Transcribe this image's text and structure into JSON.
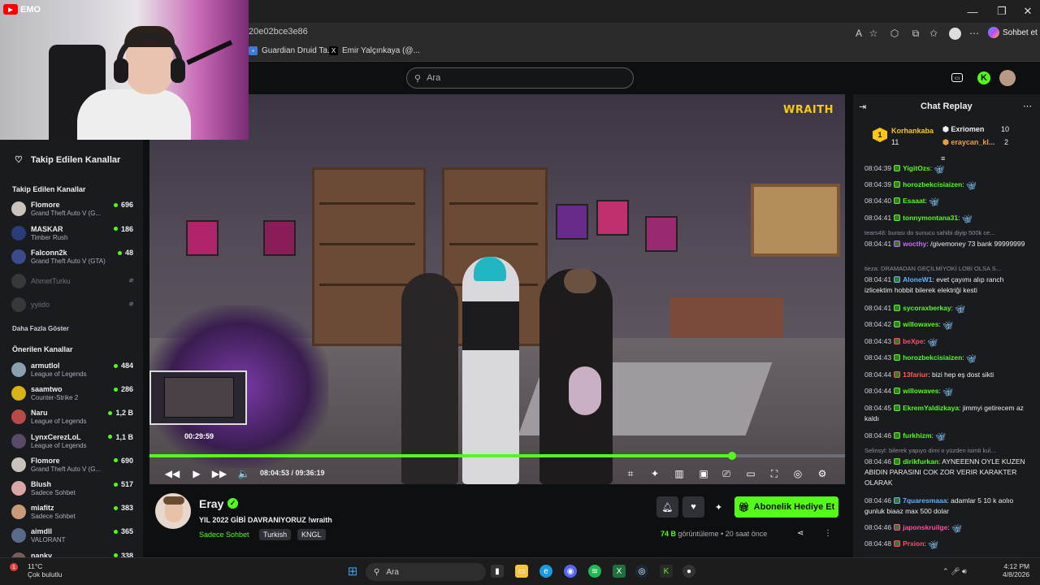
{
  "browser": {
    "url_fragment": "20e02bce3e86",
    "bookmarks": [
      {
        "label": "Guardian Druid Ta..."
      },
      {
        "label": "Emir Yalçınkaya (@..."
      }
    ],
    "copilot_label": "Sohbet et"
  },
  "overlay": {
    "youtube_badge": "EMO"
  },
  "header": {
    "search_placeholder": "Ara"
  },
  "sidebar": {
    "title": "Takip Edilen Kanallar",
    "followed_heading": "Takip Edilen Kanallar",
    "followed": [
      {
        "name": "Flomore",
        "game": "Grand Theft Auto V (G...",
        "viewers": "696",
        "color": "#c9c2bd"
      },
      {
        "name": "MASKAR",
        "game": "Timber Rush",
        "viewers": "186",
        "color": "#2b3c7a"
      },
      {
        "name": "Falconn2k",
        "game": "Grand Theft Auto V (GTA)",
        "viewers": "48",
        "color": "#3a4a8a"
      },
      {
        "name": "AhmetTurku",
        "game": "",
        "viewers": "",
        "color": "#555"
      },
      {
        "name": "yyiido",
        "game": "",
        "viewers": "",
        "color": "#555"
      }
    ],
    "show_more": "Daha Fazla Göster",
    "recommended_heading": "Önerilen Kanallar",
    "recommended": [
      {
        "name": "armutlol",
        "game": "League of Legends",
        "viewers": "484",
        "color": "#8a9fb0"
      },
      {
        "name": "saamtwo",
        "game": "Counter-Strike 2",
        "viewers": "286",
        "color": "#d9b215"
      },
      {
        "name": "Naru",
        "game": "League of Legends",
        "viewers": "1,2 B",
        "color": "#b84a4a"
      },
      {
        "name": "LynxCerezLoL",
        "game": "League of Legends",
        "viewers": "1,1 B",
        "color": "#5a4a6a"
      },
      {
        "name": "Flomore",
        "game": "Grand Theft Auto V (G...",
        "viewers": "690",
        "color": "#c9c2bd"
      },
      {
        "name": "Blush",
        "game": "Sadece Sohbet",
        "viewers": "517",
        "color": "#d9a5a5"
      },
      {
        "name": "miafitz",
        "game": "Sadece Sohbet",
        "viewers": "383",
        "color": "#c99a7a"
      },
      {
        "name": "aimdll",
        "game": "VALORANT",
        "viewers": "365",
        "color": "#5a6a8a"
      },
      {
        "name": "nanky",
        "game": "",
        "viewers": "338",
        "color": "#7a5a5a"
      }
    ]
  },
  "video": {
    "watermark": "WRAITH",
    "hover_time": "00:29:59",
    "progress_fraction": 0.838,
    "current_time": "08:04:53",
    "duration": "09:36:19",
    "time_display": "08:04:53 / 09:36:19"
  },
  "stream": {
    "streamer": "Eray",
    "title": "YIL 2022 GİBİ DAVRANIYORUZ  !wraith",
    "category": "Sadece Sohbet",
    "tags": [
      "Turkish",
      "KNGL"
    ],
    "gift_button": "Abonelik Hediye Et",
    "views_count": "74 B",
    "views_label": "görüntüleme",
    "time_ago": "20 saat önce"
  },
  "chat": {
    "title": "Chat Replay",
    "top_gifter": {
      "name": "Korhankaba",
      "count": "11"
    },
    "gifters": [
      {
        "name": "Exriomen",
        "count": "10"
      },
      {
        "name": "eraycan_kl...",
        "count": "2"
      }
    ],
    "messages": [
      {
        "time": "08:04:39",
        "user": "YigitOzs",
        "color": "#53fc18",
        "text": "",
        "emote": true
      },
      {
        "time": "08:04:39",
        "user": "horozbekcisiaizen",
        "color": "#53fc18",
        "text": "",
        "emote": true
      },
      {
        "time": "08:04:40",
        "user": "Esaaat",
        "color": "#53fc18",
        "text": "",
        "emote": true
      },
      {
        "time": "08:04:41",
        "user": "tonnymontana31",
        "color": "#53fc18",
        "text": "",
        "emote": true
      },
      {
        "reply": "tears48: burası do sunucu sahibi diyip 500k ce..."
      },
      {
        "time": "08:04:41",
        "user": "wocthy",
        "color": "#c86bff",
        "text": "/givemoney 73 bank 99999999"
      },
      {
        "reply": "tieza: DRAMADAN GEÇİLMİYOKİ LOBİ OLSA S..."
      },
      {
        "time": "08:04:41",
        "user": "AloneW1",
        "color": "#5fb4ff",
        "text": "evet çayımı alıp ranch izlicektim hobbit bilerek elektriği kesti"
      },
      {
        "time": "08:04:41",
        "user": "sycoraxberkay",
        "color": "#53fc18",
        "text": "",
        "emote": true
      },
      {
        "time": "08:04:42",
        "user": "willowaves",
        "color": "#53fc18",
        "text": "",
        "emote": true
      },
      {
        "time": "08:04:43",
        "user": "beXpe",
        "color": "#ff4d6d",
        "text": "",
        "emote": true
      },
      {
        "time": "08:04:43",
        "user": "horozbekcisiaizen",
        "color": "#53fc18",
        "text": "",
        "emote": true
      },
      {
        "time": "08:04:44",
        "user": "13fariur",
        "color": "#ff5c5c",
        "text": "bizi hep eş dost sikti"
      },
      {
        "time": "08:04:44",
        "user": "willowaves",
        "color": "#53fc18",
        "text": "",
        "emote": true
      },
      {
        "time": "08:04:45",
        "user": "EkremYaldizkaya",
        "color": "#53fc18",
        "text": "jimmyi getirecem az kaldı"
      },
      {
        "time": "08:04:46",
        "user": "furkhizm",
        "color": "#53fc18",
        "text": "",
        "emote": true
      },
      {
        "reply": "Selinsyl: bilerek yapıyo dimi o yüzden isimli kul..."
      },
      {
        "time": "08:04:46",
        "user": "dirikfurkan",
        "color": "#53fc18",
        "text": "AYNEEENN OYLE KUZEN ABIDIN PARASINI COK ZOR VERIR KARAKTER OLARAK"
      },
      {
        "time": "08:04:46",
        "user": "7quaresmaaa",
        "color": "#5fb4ff",
        "text": "adamlar 5 10 k aolıo gunluk biaaz max 500 dolar"
      },
      {
        "time": "08:04:46",
        "user": "japonskruilge",
        "color": "#ff4d9d",
        "text": "",
        "emote": true
      },
      {
        "time": "08:04:48",
        "user": "Prxion",
        "color": "#ff4d6d",
        "text": "",
        "emote": true
      }
    ]
  },
  "taskbar": {
    "weather_temp": "11°C",
    "weather_desc": "Çok bulutlu",
    "search_placeholder": "Ara",
    "time": "4:12 PM",
    "date": "4/8/2026"
  },
  "colors": {
    "accent": "#53fc18",
    "bg": "#0e0f11",
    "sidebar": "#191b1f"
  }
}
